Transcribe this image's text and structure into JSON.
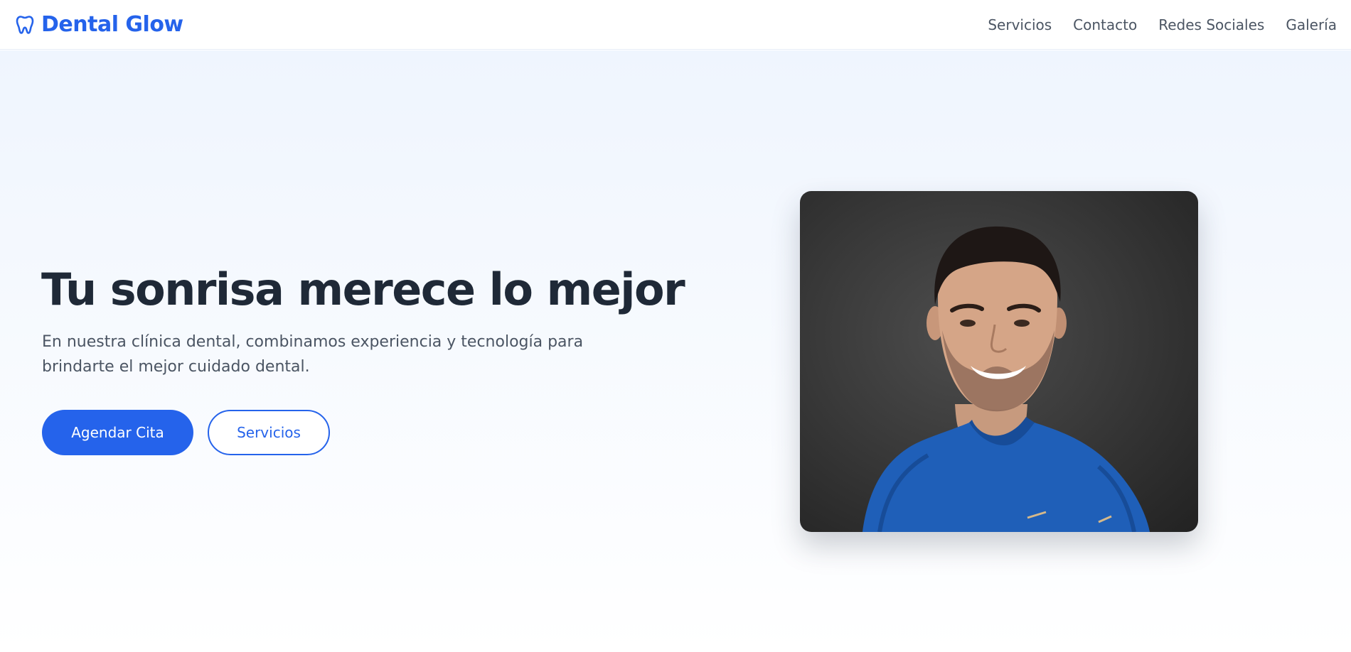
{
  "brand": {
    "name": "Dental Glow",
    "icon": "tooth-icon",
    "color": "#2563eb"
  },
  "nav": {
    "links": [
      {
        "label": "Servicios"
      },
      {
        "label": "Contacto"
      },
      {
        "label": "Redes Sociales"
      },
      {
        "label": "Galería"
      }
    ]
  },
  "hero": {
    "title": "Tu sonrisa merece lo mejor",
    "subtitle": "En nuestra clínica dental, combinamos experiencia y tecnología para brindarte el mejor cuidado dental.",
    "primary_button": "Agendar Cita",
    "secondary_button": "Servicios"
  },
  "colors": {
    "accent": "#2563eb",
    "heading": "#1f2937",
    "body_text": "#4b5563",
    "hero_bg_top": "#eff5fe"
  }
}
